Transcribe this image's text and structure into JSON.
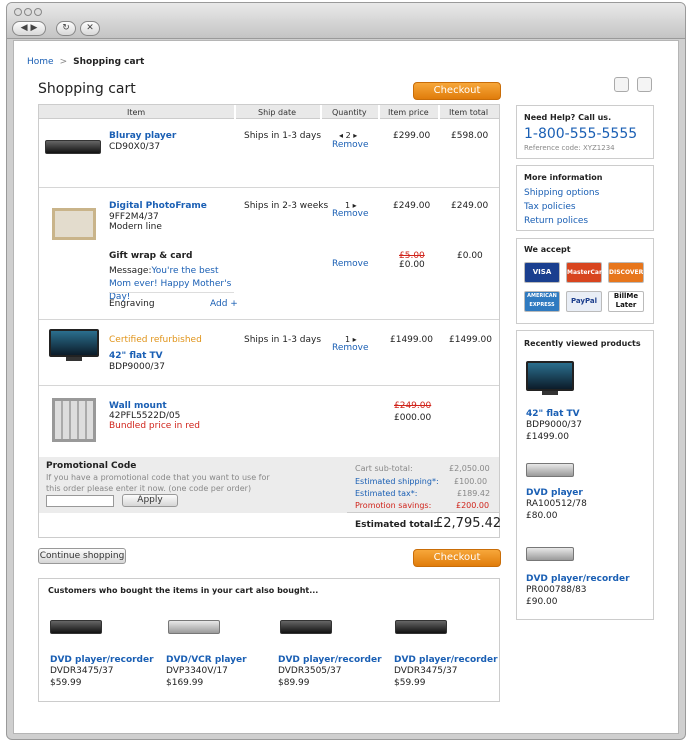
{
  "breadcrumb": {
    "home": "Home",
    "sep": ">",
    "current": "Shopping cart"
  },
  "page_title": "Shopping cart",
  "checkout_label": "Checkout",
  "table_headers": [
    "Item",
    "Ship date",
    "Quantity",
    "Item price",
    "Item total"
  ],
  "remove_label": "Remove",
  "items": [
    {
      "name": "Bluray player",
      "model": "CD90X0/37",
      "ship": "Ships in 1-3 days",
      "qty": "2",
      "price": "£299.00",
      "total": "£598.00"
    },
    {
      "name": "Digital PhotoFrame",
      "model": "9FF2M4/37",
      "line": "Modern line",
      "ship": "Ships in 2-3 weeks",
      "qty": "1",
      "price": "£249.00",
      "total": "£249.00"
    },
    {
      "name": "42\" flat TV",
      "badge": "Certified refurbished",
      "model": "BDP9000/37",
      "ship": "Ships in 1-3 days",
      "qty": "1",
      "price": "£1499.00",
      "total": "£1499.00"
    },
    {
      "name": "Wall mount",
      "model": "42PFL5522D/05",
      "note": "Bundled price in red",
      "old_price": "£249.00",
      "price": "£000.00"
    }
  ],
  "gift": {
    "title": "Gift wrap & card",
    "message_label": "Message:",
    "message": "You're the best Mom ever! Happy Mother's Day!",
    "old_price": "£5.00",
    "price": "£0.00",
    "total": "£0.00",
    "engraving": "Engraving",
    "add": "Add +"
  },
  "promo": {
    "title": "Promotional Code",
    "text": "If you have a promotional code that you want to use for this order please enter it now. (one code per order)",
    "apply": "Apply"
  },
  "totals": {
    "subtotal_label": "Cart sub-total:",
    "subtotal": "£2,050.00",
    "shipping_label": "Estimated shipping*:",
    "shipping": "£100.00",
    "tax_label": "Estimated tax*:",
    "tax": "£189.42",
    "savings_label": "Promotion savings:",
    "savings": "£200.00",
    "total_label": "Estimated total:",
    "total": "£2,795.42"
  },
  "continue_label": "Continue shopping",
  "help": {
    "title": "Need Help? Call us.",
    "phone": "1-800-555-5555",
    "ref": "Reference code: XYZ1234"
  },
  "more_info": {
    "title": "More information",
    "links": [
      "Shipping options",
      "Tax policies",
      "Return polices"
    ]
  },
  "accept": {
    "title": "We accept",
    "cards": [
      "VISA",
      "MasterCard",
      "DISCOVER",
      "AMERICAN EXPRESS",
      "PayPal",
      "BillMe Later"
    ]
  },
  "recent": {
    "title": "Recently viewed products",
    "items": [
      {
        "name": "42\" flat TV",
        "model": "BDP9000/37",
        "price": "£1499.00"
      },
      {
        "name": "DVD player",
        "model": "RA100512/78",
        "price": "£80.00"
      },
      {
        "name": "DVD player/recorder",
        "model": "PR000788/83",
        "price": "£90.00"
      }
    ]
  },
  "also": {
    "title": "Customers who bought the items in your cart also bought...",
    "items": [
      {
        "name": "DVD player/recorder",
        "model": "DVDR3475/37",
        "price": "$59.99"
      },
      {
        "name": "DVD/VCR player",
        "model": "DVP3340V/17",
        "price": "$169.99"
      },
      {
        "name": "DVD player/recorder",
        "model": "DVDR3505/37",
        "price": "$89.99"
      },
      {
        "name": "DVD player/recorder",
        "model": "DVDR3475/37",
        "price": "$59.99"
      }
    ]
  }
}
